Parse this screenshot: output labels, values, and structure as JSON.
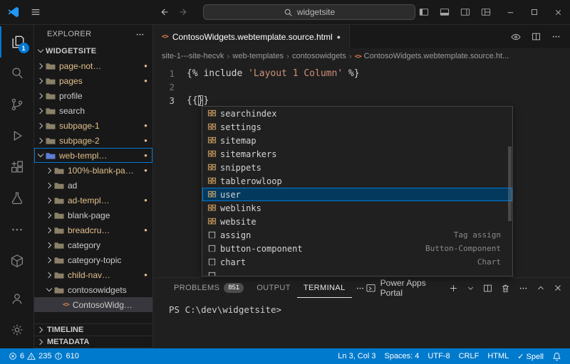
{
  "titlebar": {
    "search_value": "widgetsite"
  },
  "activitybar": {
    "explorer_badge": "1"
  },
  "sidebar": {
    "title": "EXPLORER",
    "section_label": "WIDGETSITE",
    "tree": [
      {
        "label": "page-not…",
        "indent": 1,
        "chevron": "collapsed",
        "icon": "folder",
        "modified": true
      },
      {
        "label": "pages",
        "indent": 1,
        "chevron": "collapsed",
        "icon": "folder",
        "modified": true
      },
      {
        "label": "profile",
        "indent": 1,
        "chevron": "collapsed",
        "icon": "folder",
        "modified": false
      },
      {
        "label": "search",
        "indent": 1,
        "chevron": "collapsed",
        "icon": "folder",
        "modified": false
      },
      {
        "label": "subpage-1",
        "indent": 1,
        "chevron": "collapsed",
        "icon": "folder",
        "modified": true
      },
      {
        "label": "subpage-2",
        "indent": 1,
        "chevron": "collapsed",
        "icon": "folder",
        "modified": true
      },
      {
        "label": "web-templ…",
        "indent": 1,
        "chevron": "expanded",
        "icon": "folder-blue",
        "modified": true,
        "focused": true
      },
      {
        "label": "100%-blank-pa…",
        "indent": 2,
        "chevron": "collapsed",
        "icon": "folder",
        "modified": true
      },
      {
        "label": "ad",
        "indent": 2,
        "chevron": "collapsed",
        "icon": "folder",
        "modified": false
      },
      {
        "label": "ad-templ…",
        "indent": 2,
        "chevron": "collapsed",
        "icon": "folder",
        "modified": true
      },
      {
        "label": "blank-page",
        "indent": 2,
        "chevron": "collapsed",
        "icon": "folder",
        "modified": false
      },
      {
        "label": "breadcru…",
        "indent": 2,
        "chevron": "collapsed",
        "icon": "folder",
        "modified": true
      },
      {
        "label": "category",
        "indent": 2,
        "chevron": "collapsed",
        "icon": "folder",
        "modified": false
      },
      {
        "label": "category-topic",
        "indent": 2,
        "chevron": "collapsed",
        "icon": "folder",
        "modified": false
      },
      {
        "label": "child-nav…",
        "indent": 2,
        "chevron": "collapsed",
        "icon": "folder",
        "modified": true
      },
      {
        "label": "contosowidgets",
        "indent": 2,
        "chevron": "expanded",
        "icon": "folder",
        "modified": false
      },
      {
        "label": "ContosoWidg…",
        "indent": 3,
        "chevron": "none",
        "icon": "html",
        "modified": false,
        "selected": true
      }
    ],
    "footer_sections": [
      "TIMELINE",
      "METADATA"
    ]
  },
  "editor": {
    "tab_title": "ContosoWidgets.webtemplate.source.html",
    "breadcrumbs": [
      "site-1---site-hecvk",
      "web-templates",
      "contosowidgets",
      "ContosoWidgets.webtemplate.source.ht..."
    ],
    "line_numbers": [
      "1",
      "2",
      "3"
    ],
    "code": {
      "line1": {
        "pre": "{% include ",
        "string": "'Layout 1 Column'",
        "post": " %}"
      },
      "line3": {
        "pre": "{{",
        "cursor": "}",
        "post": "}"
      }
    }
  },
  "suggest": {
    "items": [
      {
        "label": "searchindex",
        "kind": "module",
        "detail": ""
      },
      {
        "label": "settings",
        "kind": "module",
        "detail": ""
      },
      {
        "label": "sitemap",
        "kind": "module",
        "detail": ""
      },
      {
        "label": "sitemarkers",
        "kind": "module",
        "detail": ""
      },
      {
        "label": "snippets",
        "kind": "module",
        "detail": ""
      },
      {
        "label": "tablerowloop",
        "kind": "module",
        "detail": ""
      },
      {
        "label": "user",
        "kind": "module",
        "detail": "",
        "selected": true
      },
      {
        "label": "weblinks",
        "kind": "module",
        "detail": ""
      },
      {
        "label": "website",
        "kind": "module",
        "detail": ""
      },
      {
        "label": "assign",
        "kind": "snippet",
        "detail": "Tag assign"
      },
      {
        "label": "button-component",
        "kind": "snippet",
        "detail": "Button-Component"
      },
      {
        "label": "chart",
        "kind": "snippet",
        "detail": "Chart"
      },
      {
        "label": "",
        "kind": "snippet",
        "detail": ""
      }
    ]
  },
  "panel": {
    "tabs": [
      {
        "label": "PROBLEMS",
        "badge": "851",
        "active": false
      },
      {
        "label": "OUTPUT",
        "badge": "",
        "active": false
      },
      {
        "label": "TERMINAL",
        "badge": "",
        "active": true
      }
    ],
    "profile_label": "Power Apps Portal",
    "terminal_prompt": "PS C:\\dev\\widgetsite>"
  },
  "statusbar": {
    "errors": "6",
    "warnings": "235",
    "infos": "610",
    "items_right": [
      "Ln 3, Col 3",
      "Spaces: 4",
      "UTF-8",
      "CRLF",
      "HTML",
      "✓ Spell"
    ]
  }
}
